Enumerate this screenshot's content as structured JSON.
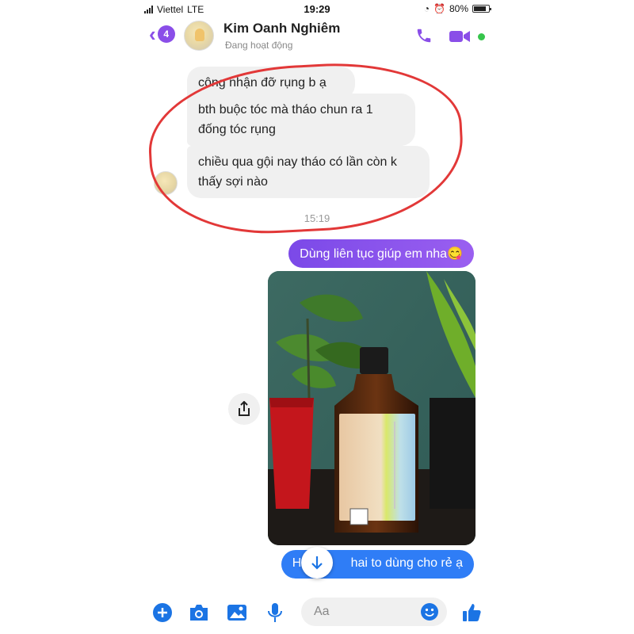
{
  "status_bar": {
    "carrier": "Viettel",
    "network": "LTE",
    "time": "19:29",
    "battery": "80%"
  },
  "header": {
    "back_badge": "4",
    "contact_name": "Kim Oanh Nghiêm",
    "presence": "Đang hoạt động",
    "accent_color": "#8a4ee8",
    "online_color": "#36c54b"
  },
  "messages": {
    "incoming": [
      "công nhận đỡ rụng b ạ",
      "bth buộc tóc mà tháo chun ra 1 đống tóc rụng",
      "chiều qua gội nay tháo có lần còn k thấy sợi nào"
    ],
    "timestamp": "15:19",
    "outgoing_1": "Dùng liên tục giúp em nha😋",
    "outgoing_2_start": "Hết chị",
    "outgoing_2_end": "hai to dùng cho rẻ ạ",
    "outgoing_color_1": "#8a54ee",
    "outgoing_color_2": "#2f7df6"
  },
  "composer": {
    "placeholder": "Aa",
    "icons": [
      "plus-icon",
      "camera-icon",
      "gallery-icon",
      "microphone-icon",
      "emoji-icon",
      "thumbs-up-icon"
    ],
    "icon_color": "#1b74e4"
  },
  "annotation_color": "#e23838"
}
